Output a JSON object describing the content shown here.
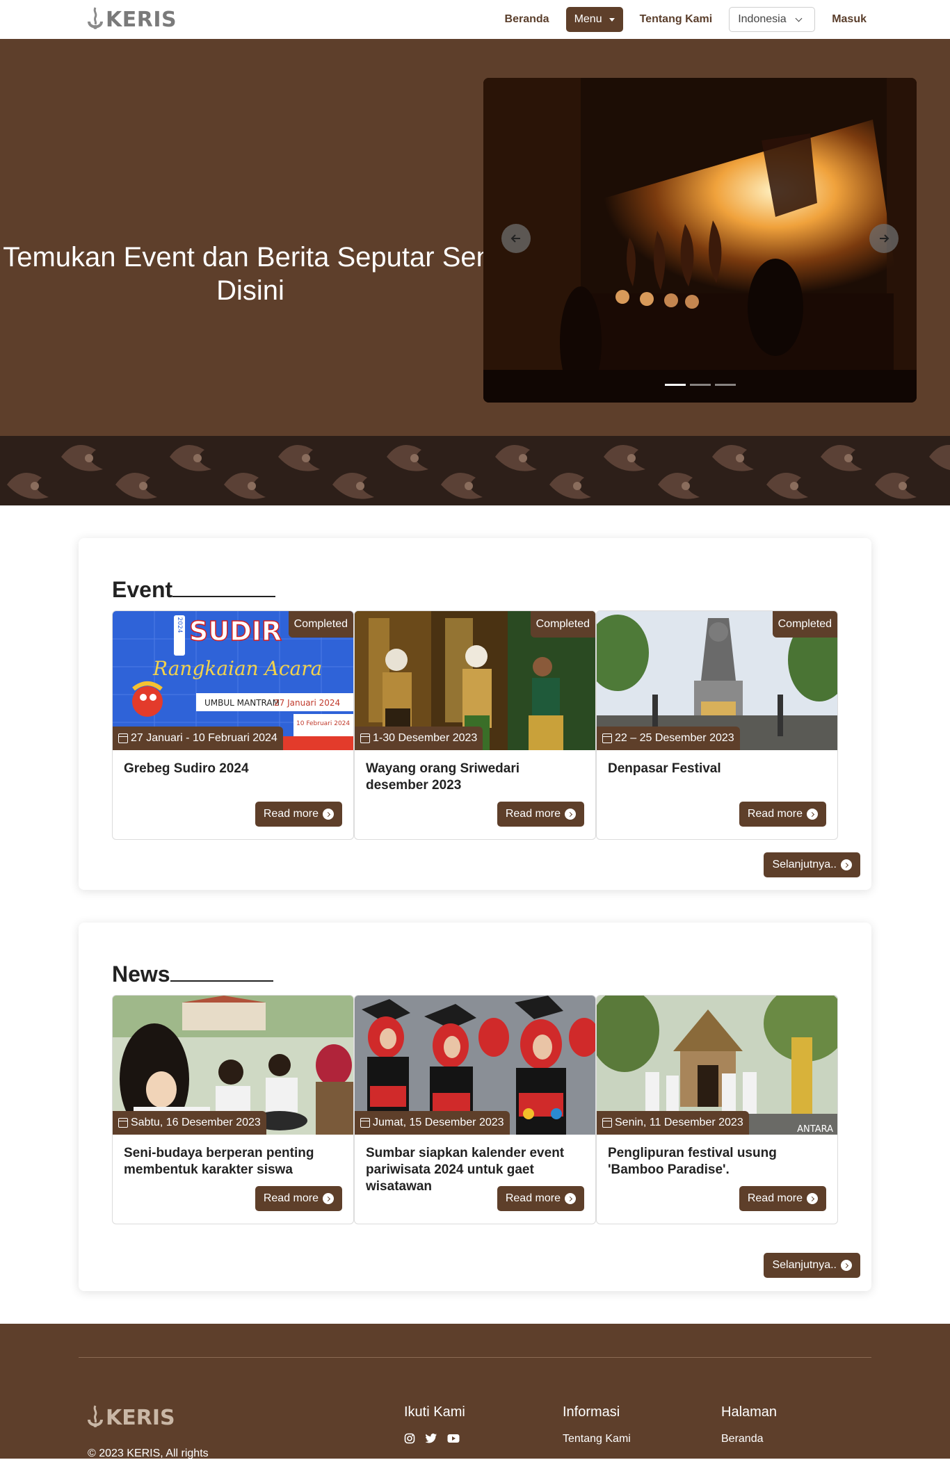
{
  "brand": {
    "name": "KERIS"
  },
  "nav": {
    "home": "Beranda",
    "menu": "Menu",
    "about": "Tentang Kami",
    "language": "Indonesia",
    "login": "Masuk"
  },
  "hero": {
    "title": "Temukan Event dan Berita Seputar Seni Disini",
    "slides_total": 3,
    "active_slide": 1,
    "prev_icon": "arrow-left-icon",
    "next_icon": "arrow-right-icon"
  },
  "events": {
    "title": "Event",
    "items": [
      {
        "status": "Completed",
        "date": "27 Januari - 10 Februari 2024",
        "title": "Grebeg Sudiro 2024",
        "read_more": "Read more",
        "poster_word": "SUDIR",
        "poster_script": "Rangkaian Acara",
        "poster_sub1": "UMBUL MANTRAM",
        "poster_sub2": "27 Januari 2024",
        "poster_sub3": "10 Februari 2024",
        "poster_year": "2024"
      },
      {
        "status": "Completed",
        "date": "1-30 Desember 2023",
        "title": "Wayang orang Sriwedari desember 2023",
        "read_more": "Read more"
      },
      {
        "status": "Completed",
        "date": "22 – 25 Desember 2023",
        "title": "Denpasar Festival",
        "read_more": "Read more"
      }
    ],
    "next": "Selanjutnya.."
  },
  "news": {
    "title": "News",
    "items": [
      {
        "date": "Sabtu, 16 Desember 2023",
        "title": "Seni-budaya berperan penting membentuk karakter siswa",
        "read_more": "Read more"
      },
      {
        "date": "Jumat, 15 Desember 2023",
        "title": "Sumbar siapkan kalender event pariwisata 2024 untuk gaet wisatawan",
        "read_more": "Read more"
      },
      {
        "date": "Senin, 11 Desember 2023",
        "title": "Penglipuran festival usung 'Bamboo Paradise'.",
        "read_more": "Read more",
        "watermark": "ANTARA"
      }
    ],
    "next": "Selanjutnya.."
  },
  "footer": {
    "copyright": "© 2023 KERIS, All rights",
    "follow": {
      "title": "Ikuti Kami",
      "icons": [
        "instagram-icon",
        "twitter-icon",
        "youtube-icon"
      ]
    },
    "info": {
      "title": "Informasi",
      "links": [
        "Tentang Kami"
      ]
    },
    "pages": {
      "title": "Halaman",
      "links": [
        "Beranda"
      ]
    }
  },
  "colors": {
    "primary": "#5e3f2a",
    "hero_bg": "#5e3f2b",
    "batik_bg": "#2d1f19",
    "logo_grey": "#7a7a7a"
  }
}
